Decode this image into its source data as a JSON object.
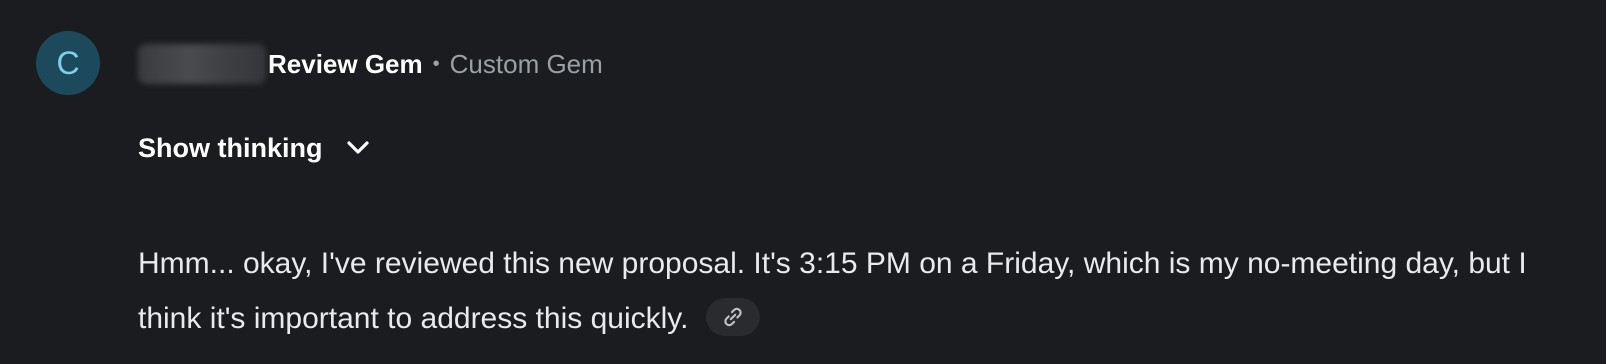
{
  "avatar": {
    "letter": "C",
    "bg_color": "#1c4a5c",
    "fg_color": "#7fcfea"
  },
  "header": {
    "gem_name": "Review Gem",
    "separator": "•",
    "gem_type": "Custom Gem"
  },
  "thinking": {
    "label": "Show thinking",
    "icon": "chevron-down-icon"
  },
  "message": {
    "text": "Hmm... okay, I've reviewed this new proposal. It's 3:15 PM on a Friday, which is my no-meeting day, but I think it's important to address this quickly.",
    "link_icon": "link-icon"
  }
}
